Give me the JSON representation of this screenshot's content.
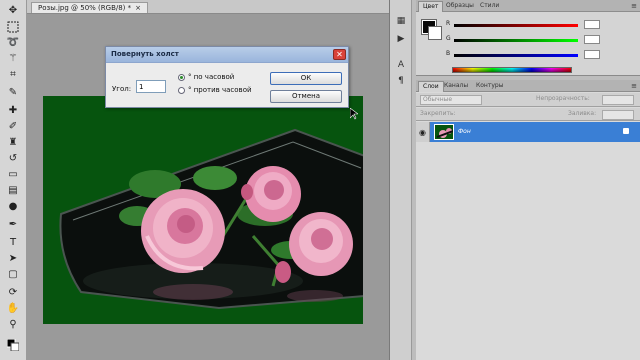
{
  "document": {
    "tab_label": "Розы.jpg @ 50% (RGB/8) *",
    "tab_close": "×"
  },
  "dialog": {
    "title": "Повернуть холст",
    "close": "✕",
    "angle_label": "Угол:",
    "angle_value": "1",
    "option_cw": "° по часовой",
    "option_ccw": "° против часовой",
    "selected_option": "cw",
    "ok_label": "ОК",
    "cancel_label": "Отмена"
  },
  "color_panel": {
    "tabs": [
      "Цвет",
      "Образцы",
      "Стили"
    ],
    "foreground": "#0a0a0a",
    "background": "#ffffff",
    "sliders": [
      {
        "letter": "R",
        "color": "#d02020"
      },
      {
        "letter": "G",
        "color": "#20a020"
      },
      {
        "letter": "B",
        "color": "#2020d0"
      }
    ]
  },
  "layers_panel": {
    "tabs": [
      "Слои",
      "Каналы",
      "Контуры"
    ],
    "blend_mode": "Обычные",
    "opacity_label": "Непрозрачность:",
    "lock_label": "Закрепить:",
    "fill_label": "Заливка:",
    "layer_name": "Фон"
  },
  "colors": {
    "canvas_green": "#06540e",
    "selection_blue": "#3a7fd5"
  }
}
